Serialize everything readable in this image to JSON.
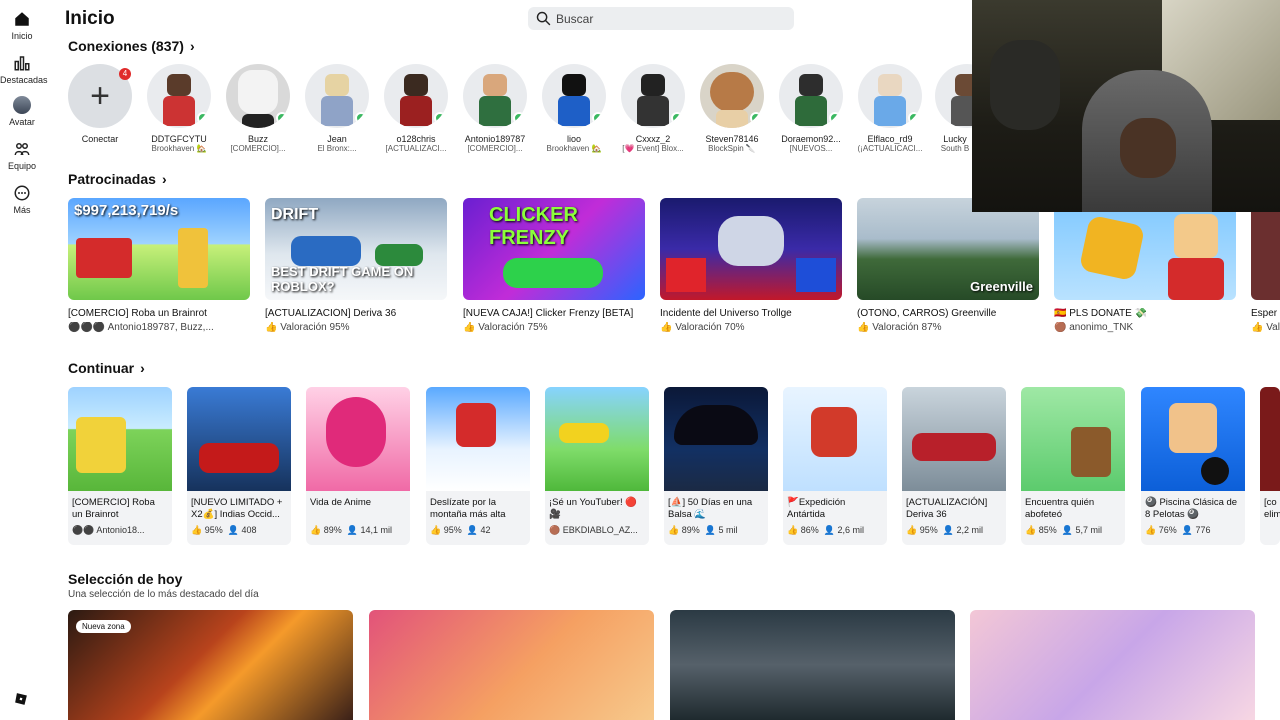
{
  "sidebar": {
    "items": [
      {
        "label": "Inicio",
        "icon": "home-icon"
      },
      {
        "label": "Destacadas",
        "icon": "charts-icon"
      },
      {
        "label": "Avatar",
        "icon": "avatar-icon"
      },
      {
        "label": "Equipo",
        "icon": "team-icon"
      },
      {
        "label": "Más",
        "icon": "more-icon"
      }
    ]
  },
  "header": {
    "title": "Inicio",
    "search_placeholder": "Buscar"
  },
  "connections": {
    "title": "Conexiones (837)",
    "badge": "4",
    "add_label": "Conectar",
    "items": [
      {
        "name": "DDTGFCYTU",
        "game": "Brookhaven 🏡"
      },
      {
        "name": "Buzz",
        "game": "[COMERCIO]..."
      },
      {
        "name": "Jean",
        "game": "El Bronx:..."
      },
      {
        "name": "o128chris",
        "game": "[ACTUALIZACI..."
      },
      {
        "name": "Antonio189787",
        "game": "[COMERCIO]..."
      },
      {
        "name": "lioo",
        "game": "Brookhaven 🏡"
      },
      {
        "name": "Cxxxz_2",
        "game": "[💗 Event] Blox..."
      },
      {
        "name": "Steven78146",
        "game": "BlockSpin 🔪"
      },
      {
        "name": "Doraemon92...",
        "game": "[NUEVOS..."
      },
      {
        "name": "Elflaco_rd9",
        "game": "(¡ACTUALICACI..."
      },
      {
        "name": "Lucky",
        "game": "South B"
      }
    ]
  },
  "sponsored": {
    "title": "Patrocinadas",
    "items": [
      {
        "title": "[COMERCIO] Roba un Brainrot",
        "meta": "Antonio189787, Buzz,...",
        "overlay": "$997,213,719/s"
      },
      {
        "title": "[ACTUALIZACIÓN] Deriva 36",
        "meta": "Valoración 95%",
        "overlay": "BEST DRIFT GAME ON ROBLOX?"
      },
      {
        "title": "[NUEVA CAJA!] Clicker Frenzy [BETA]",
        "meta": "Valoración 75%",
        "overlay": "CLICKER FRENZY"
      },
      {
        "title": "Incidente del Universo Trollge",
        "meta": "Valoración 70%",
        "overlay": ""
      },
      {
        "title": "(OTOÑO, CARROS) Greenville",
        "meta": "Valoración 87%",
        "overlay": "Greenville"
      },
      {
        "title": "🇪🇸 PLS DONATE 💸",
        "meta": "anonimo_TNK",
        "overlay": ""
      },
      {
        "title": "Esper",
        "meta": "Val",
        "overlay": ""
      }
    ]
  },
  "continue": {
    "title": "Continuar",
    "items": [
      {
        "title": "[COMERCIO] Roba un Brainrot",
        "rating": "",
        "players": "Antonio18..."
      },
      {
        "title": "[NUEVO LIMITADO + X2💰] Indias Occid...",
        "rating": "95%",
        "players": "408"
      },
      {
        "title": "Vida de Anime",
        "rating": "89%",
        "players": "14,1 mil"
      },
      {
        "title": "Deslízate por la montaña más alta",
        "rating": "95%",
        "players": "42"
      },
      {
        "title": "¡Sé un YouTuber! 🔴🎥",
        "rating": "",
        "players": "EBKDIABLO_AZ..."
      },
      {
        "title": "[⛵] 50 Días en una Balsa 🌊",
        "rating": "89%",
        "players": "5 mil"
      },
      {
        "title": "🚩Expedición Antártida",
        "rating": "86%",
        "players": "2,6 mil"
      },
      {
        "title": "[ACTUALIZACIÓN] Deriva 36",
        "rating": "95%",
        "players": "2,2 mil"
      },
      {
        "title": "Encuentra quién abofeteó",
        "rating": "85%",
        "players": "5,7 mil"
      },
      {
        "title": "🎱 Piscina Clásica de 8 Pelotas 🎱",
        "rating": "76%",
        "players": "776"
      },
      {
        "title": "[co elim",
        "rating": "",
        "players": ""
      }
    ]
  },
  "today": {
    "title": "Selección de hoy",
    "subtitle": "Una selección de lo más destacado del día",
    "badge": "Nueva zona"
  },
  "colors": {
    "online": "#3bb861",
    "badge": "#e02b2b",
    "card_bg": "#f2f3f5"
  }
}
